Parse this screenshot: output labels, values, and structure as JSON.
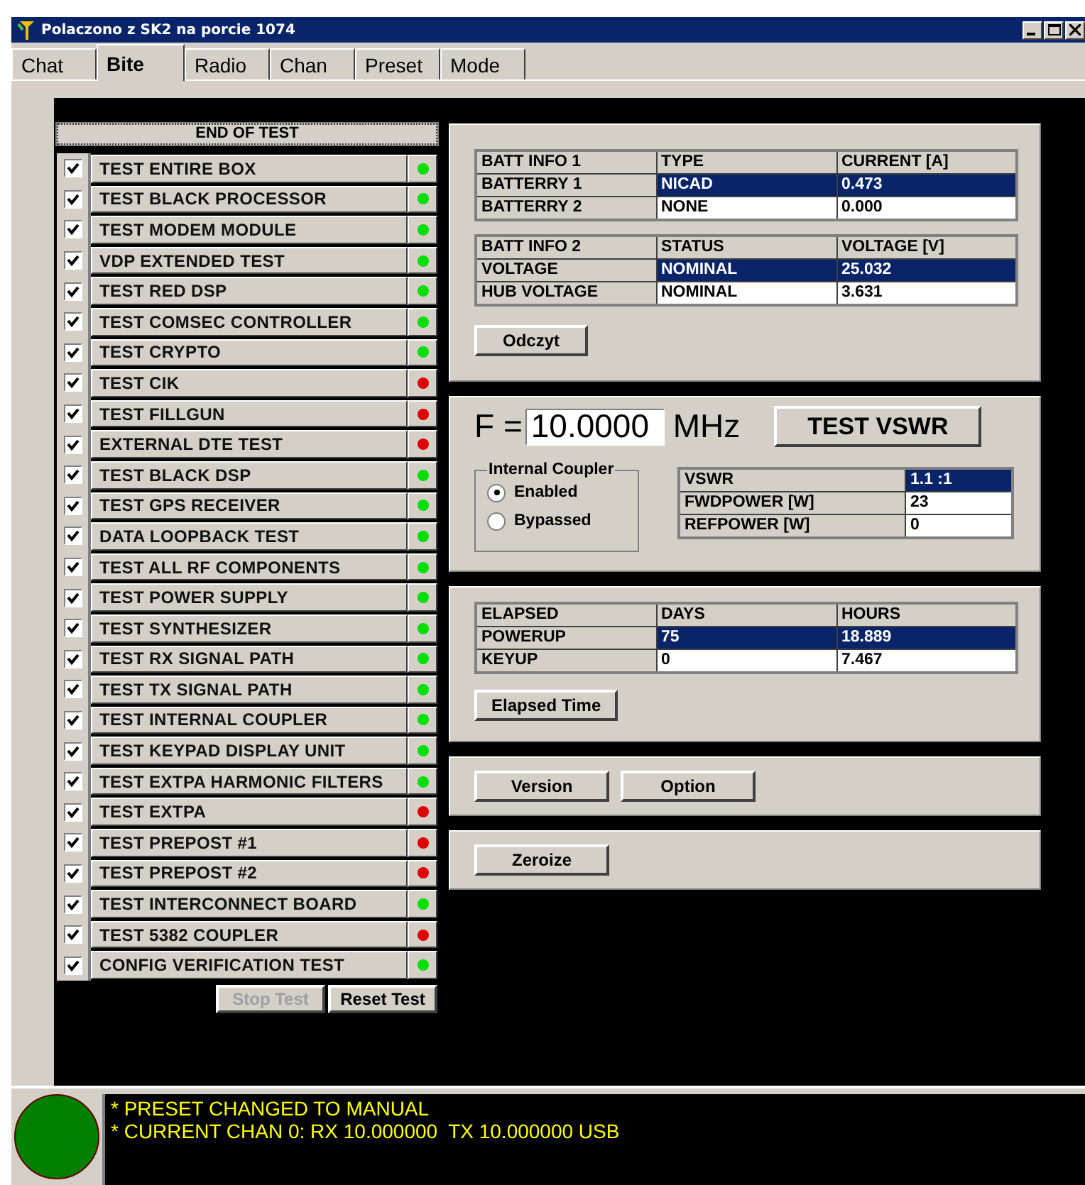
{
  "window": {
    "title": "Polaczono z SK2 na porcie 1074"
  },
  "tabs": [
    {
      "label": "Chat",
      "selected": false
    },
    {
      "label": "Bite",
      "selected": true
    },
    {
      "label": "Radio",
      "selected": false
    },
    {
      "label": "Chan",
      "selected": false
    },
    {
      "label": "Preset",
      "selected": false
    },
    {
      "label": "Mode",
      "selected": false
    }
  ],
  "end_of_test": "END OF TEST",
  "tests": [
    {
      "name": "TEST ENTIRE BOX",
      "checked": true,
      "color": "#00e000"
    },
    {
      "name": "TEST BLACK PROCESSOR",
      "checked": true,
      "color": "#00e000"
    },
    {
      "name": "TEST MODEM MODULE",
      "checked": true,
      "color": "#00e000"
    },
    {
      "name": "VDP EXTENDED TEST",
      "checked": true,
      "color": "#00e000"
    },
    {
      "name": "TEST RED DSP",
      "checked": true,
      "color": "#00e000"
    },
    {
      "name": "TEST COMSEC CONTROLLER",
      "checked": true,
      "color": "#00e000"
    },
    {
      "name": "TEST CRYPTO",
      "checked": true,
      "color": "#00e000"
    },
    {
      "name": "TEST CIK",
      "checked": true,
      "color": "#e00000"
    },
    {
      "name": "TEST FILLGUN",
      "checked": true,
      "color": "#e00000"
    },
    {
      "name": "EXTERNAL DTE TEST",
      "checked": true,
      "color": "#e00000"
    },
    {
      "name": "TEST BLACK DSP",
      "checked": true,
      "color": "#00e000"
    },
    {
      "name": "TEST GPS RECEIVER",
      "checked": true,
      "color": "#00e000"
    },
    {
      "name": "DATA LOOPBACK TEST",
      "checked": true,
      "color": "#00e000"
    },
    {
      "name": "TEST ALL RF COMPONENTS",
      "checked": true,
      "color": "#00e000"
    },
    {
      "name": "TEST POWER SUPPLY",
      "checked": true,
      "color": "#00e000"
    },
    {
      "name": "TEST SYNTHESIZER",
      "checked": true,
      "color": "#00e000"
    },
    {
      "name": "TEST RX SIGNAL PATH",
      "checked": true,
      "color": "#00e000"
    },
    {
      "name": "TEST TX SIGNAL PATH",
      "checked": true,
      "color": "#00e000"
    },
    {
      "name": "TEST INTERNAL COUPLER",
      "checked": true,
      "color": "#00e000"
    },
    {
      "name": "TEST KEYPAD DISPLAY UNIT",
      "checked": true,
      "color": "#00e000"
    },
    {
      "name": "TEST EXTPA HARMONIC FILTERS",
      "checked": true,
      "color": "#00e000"
    },
    {
      "name": "TEST EXTPA",
      "checked": true,
      "color": "#e00000"
    },
    {
      "name": "TEST PREPOST #1",
      "checked": true,
      "color": "#e00000"
    },
    {
      "name": "TEST PREPOST #2",
      "checked": true,
      "color": "#e00000"
    },
    {
      "name": "TEST INTERCONNECT BOARD",
      "checked": true,
      "color": "#00e000"
    },
    {
      "name": "TEST 5382 COUPLER",
      "checked": true,
      "color": "#e00000"
    },
    {
      "name": "CONFIG VERIFICATION TEST",
      "checked": true,
      "color": "#00e000"
    }
  ],
  "test_buttons": [
    {
      "label": "Stop Test",
      "disabled": true
    },
    {
      "label": "Reset Test",
      "disabled": false
    }
  ],
  "batt_info_1": {
    "columns": [
      "BATT INFO 1",
      "TYPE",
      "CURRENT [A]"
    ],
    "rows": [
      {
        "cells": [
          "BATTERRY 1",
          "NICAD",
          "0.473"
        ],
        "selected": true
      },
      {
        "cells": [
          "BATTERRY 2",
          "NONE",
          "0.000"
        ],
        "selected": false
      }
    ]
  },
  "batt_info_2": {
    "columns": [
      "BATT INFO 2",
      "STATUS",
      "VOLTAGE [V]"
    ],
    "rows": [
      {
        "cells": [
          "VOLTAGE",
          "NOMINAL",
          "25.032"
        ],
        "selected": true
      },
      {
        "cells": [
          "HUB VOLTAGE",
          "NOMINAL",
          "3.631"
        ],
        "selected": false
      }
    ]
  },
  "read_button": "Odczyt",
  "frequency": {
    "label": "F =",
    "value": "10.0000",
    "unit": "MHz",
    "button": "TEST VSWR"
  },
  "internal_coupler": {
    "title": "Internal Coupler",
    "options": [
      {
        "label": "Enabled",
        "selected": true
      },
      {
        "label": "Bypassed",
        "selected": false
      }
    ]
  },
  "vswr_table": {
    "rows": [
      {
        "cells": [
          "VSWR",
          "1.1 :1"
        ],
        "selected": true
      },
      {
        "cells": [
          "FWDPOWER [W]",
          "23"
        ],
        "selected": false
      },
      {
        "cells": [
          "REFPOWER [W]",
          "0"
        ],
        "selected": false
      }
    ]
  },
  "elapsed": {
    "columns": [
      "ELAPSED",
      "DAYS",
      "HOURS"
    ],
    "rows": [
      {
        "cells": [
          "POWERUP",
          "75",
          "18.889"
        ],
        "selected": true
      },
      {
        "cells": [
          "KEYUP",
          "0",
          "7.467"
        ],
        "selected": false
      }
    ]
  },
  "elapsed_button": "Elapsed Time",
  "info_buttons": [
    "Version",
    "Option"
  ],
  "zeroize_button": "Zeroize",
  "status": {
    "lines": [
      "* PRESET CHANGED TO MANUAL",
      "* CURRENT CHAN 0: RX 10.000000  TX 10.000000 USB"
    ]
  }
}
